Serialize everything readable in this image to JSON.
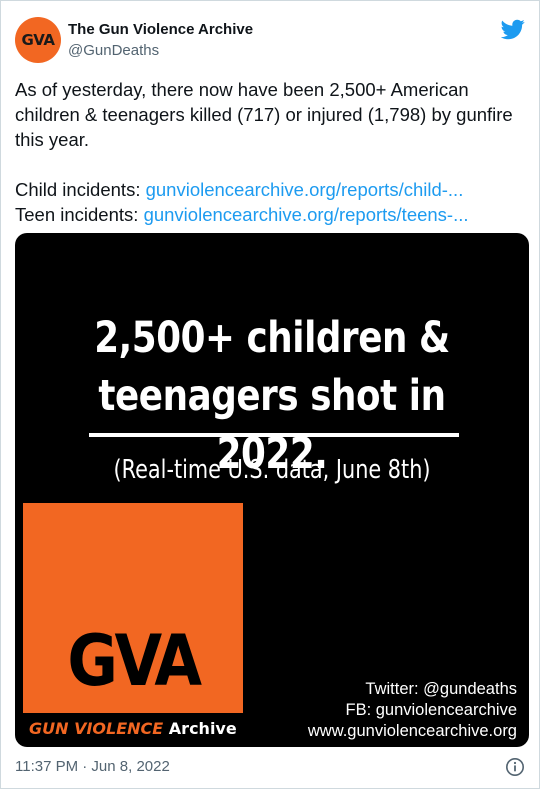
{
  "author": {
    "avatar_text": "GVA",
    "display_name": "The Gun Violence Archive",
    "handle": "@GunDeaths"
  },
  "tweet": {
    "text_line": "As of yesterday, there now have been 2,500+ American children & teenagers killed (717) or injured (1,798) by gunfire this year.",
    "child_label": "Child incidents:",
    "child_link": "gunviolencearchive.org/reports/child-...",
    "teen_label": "Teen incidents:",
    "teen_link": "gunviolencearchive.org/reports/teens-..."
  },
  "media": {
    "headline_line1": "2,500+ children &",
    "headline_line2": "teenagers shot in 2022.",
    "subhead": "(Real-time U.S. data, June 8th)",
    "logo_letters": "GVA",
    "logo_caption_part1": "GUN VIOLENCE",
    "logo_caption_part2": "Archive",
    "contact_twitter": "Twitter: @gundeaths",
    "contact_fb": "FB: gunviolencearchive",
    "contact_web": "www.gunviolencearchive.org"
  },
  "footer": {
    "timestamp": "11:37 PM · Jun 8, 2022"
  },
  "icons": {
    "brand": "twitter-bird-icon",
    "info": "info-icon"
  },
  "colors": {
    "link": "#1d9bf0",
    "gva_orange": "#f26722",
    "secondary_text": "#536471",
    "media_background": "#000000"
  }
}
